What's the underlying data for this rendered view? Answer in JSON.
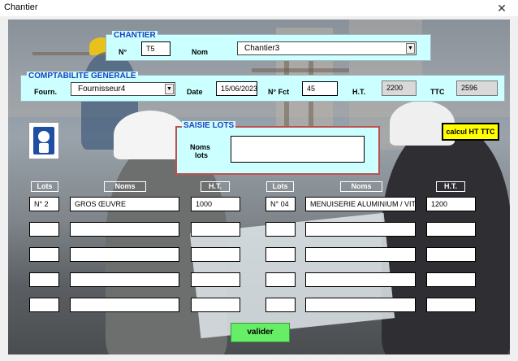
{
  "window": {
    "title": "Chantier",
    "close_glyph": "✕"
  },
  "chantier": {
    "legend": "CHANTIER",
    "num_label": "N°",
    "num_value": "T5",
    "nom_label": "Nom",
    "nom_value": "Chantier3"
  },
  "compta": {
    "legend": "COMPTABILITE GENERALE",
    "fourn_label": "Fourn.",
    "fourn_value": "Fournisseur4",
    "date_label": "Date",
    "date_value": "15/06/2023",
    "fct_label": "N° Fct",
    "fct_value": "45",
    "ht_label": "H.T.",
    "ht_value": "2200",
    "ttc_label": "TTC",
    "ttc_value": "2596"
  },
  "saisie": {
    "legend": "SAISIE LOTS",
    "noms_label_1": "Noms",
    "noms_label_2": "lots",
    "noms_value": ""
  },
  "buttons": {
    "calc": "calcul HT TTC",
    "valider": "valider"
  },
  "headers": {
    "lots": "Lots",
    "noms": "Noms",
    "ht": "H.T."
  },
  "left_rows": [
    {
      "lot": "N° 2",
      "nom": "GROS ŒUVRE",
      "ht": "1000"
    },
    {
      "lot": "",
      "nom": "",
      "ht": ""
    },
    {
      "lot": "",
      "nom": "",
      "ht": ""
    },
    {
      "lot": "",
      "nom": "",
      "ht": ""
    },
    {
      "lot": "",
      "nom": "",
      "ht": ""
    }
  ],
  "right_rows": [
    {
      "lot": "N° 04",
      "nom": "MENUISERIE ALUMINIUM / VITRER",
      "ht": "1200"
    },
    {
      "lot": "",
      "nom": "",
      "ht": ""
    },
    {
      "lot": "",
      "nom": "",
      "ht": ""
    },
    {
      "lot": "",
      "nom": "",
      "ht": ""
    },
    {
      "lot": "",
      "nom": "",
      "ht": ""
    }
  ],
  "icons": {
    "logo": "safety-helmet-sign-icon",
    "dropdown": "chevron-down-icon",
    "close": "close-icon"
  }
}
